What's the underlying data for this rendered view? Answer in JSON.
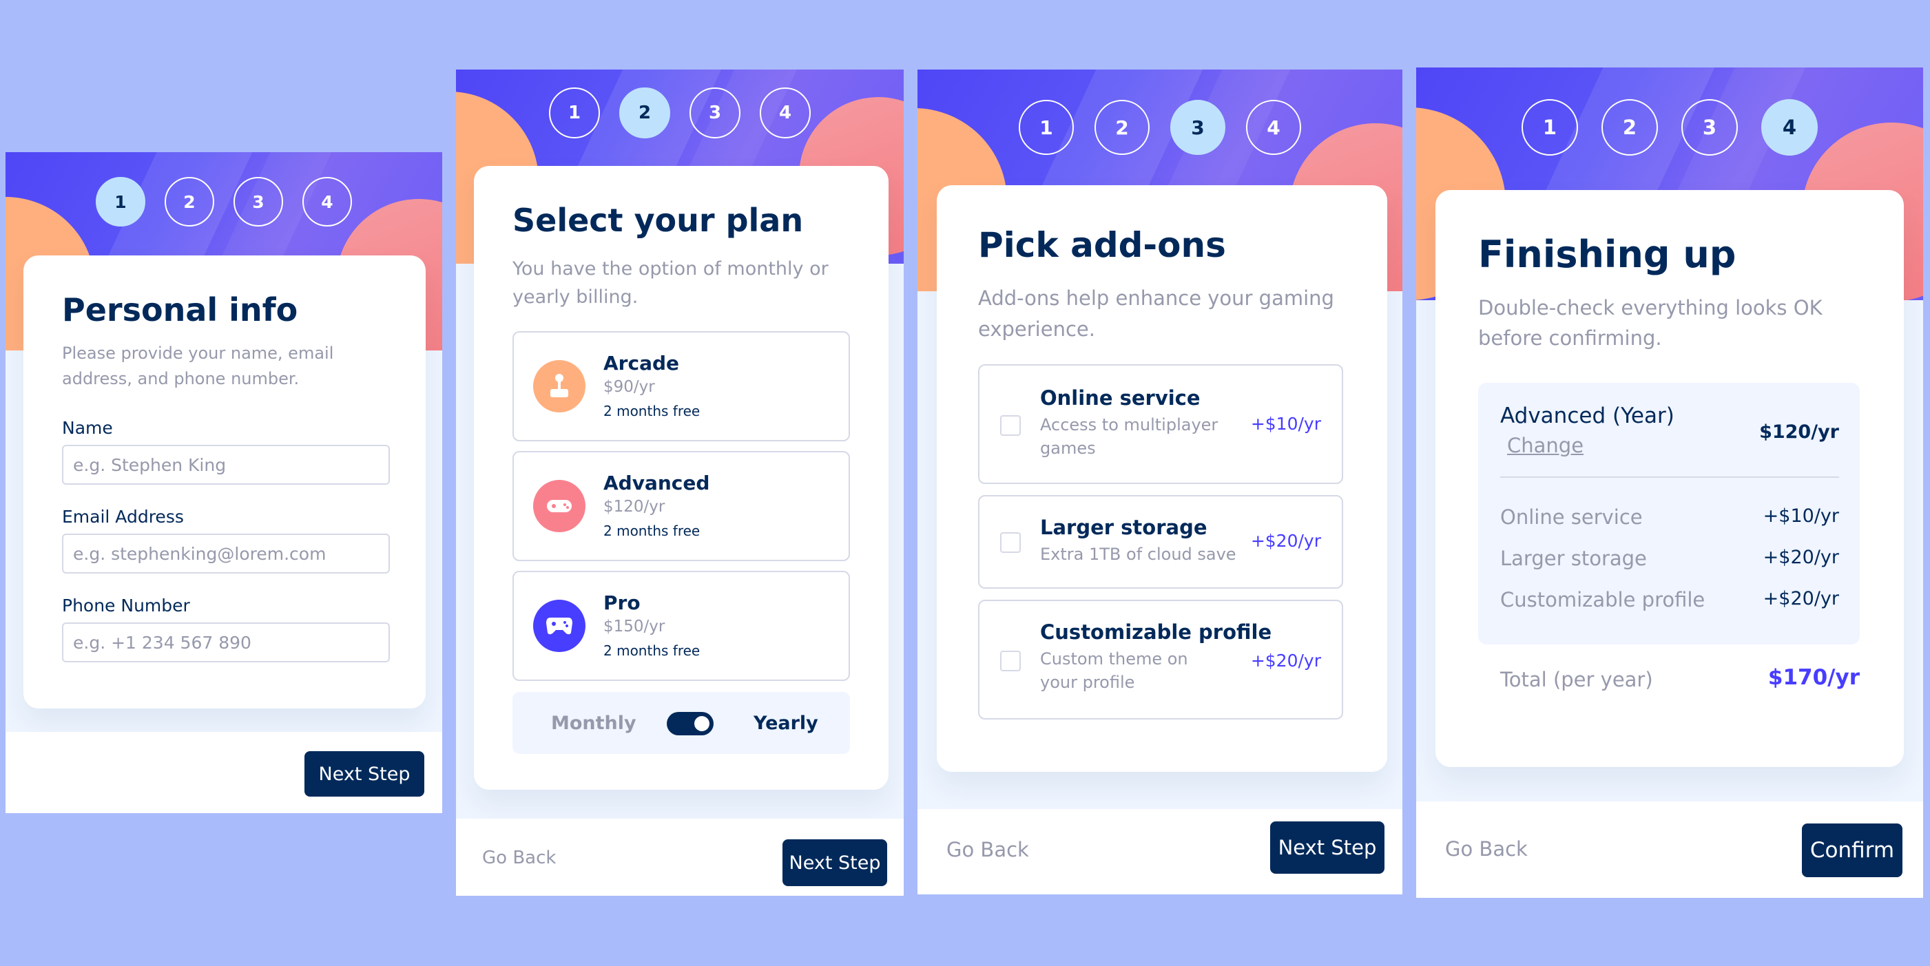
{
  "personal": {
    "steps": [
      "1",
      "2",
      "3",
      "4"
    ],
    "title": "Personal info",
    "subtitle": "Please provide your name, email address, and phone number.",
    "fields": [
      {
        "label": "Name",
        "placeholder": "e.g. Stephen King"
      },
      {
        "label": "Email Address",
        "placeholder": "e.g. stephenking@lorem.com"
      },
      {
        "label": "Phone Number",
        "placeholder": "e.g. +1 234 567 890"
      }
    ],
    "next": "Next Step"
  },
  "plan": {
    "steps": [
      "1",
      "2",
      "3",
      "4"
    ],
    "title": "Select your plan",
    "subtitle": "You have the option of monthly or yearly billing.",
    "plans": [
      {
        "name": "Arcade",
        "price": "$90/yr",
        "free": "2 months free",
        "icon": "arcade-icon",
        "color": "#ffaf7e"
      },
      {
        "name": "Advanced",
        "price": "$120/yr",
        "free": "2 months free",
        "icon": "gamepad-icon",
        "color": "#f9818e"
      },
      {
        "name": "Pro",
        "price": "$150/yr",
        "free": "2 months free",
        "icon": "controller-icon",
        "color": "#483eff"
      }
    ],
    "toggle": {
      "monthly": "Monthly",
      "yearly": "Yearly"
    },
    "back": "Go Back",
    "next": "Next Step"
  },
  "addons": {
    "steps": [
      "1",
      "2",
      "3",
      "4"
    ],
    "title": "Pick add-ons",
    "subtitle": "Add-ons help enhance your gaming experience.",
    "items": [
      {
        "name": "Online service",
        "desc": "Access to multiplayer games",
        "price": "+$10/yr"
      },
      {
        "name": "Larger storage",
        "desc": "Extra 1TB of cloud save",
        "price": "+$20/yr"
      },
      {
        "name": "Customizable profile",
        "desc": "Custom theme on your profile",
        "price": "+$20/yr"
      }
    ],
    "back": "Go Back",
    "next": "Next Step"
  },
  "summary": {
    "steps": [
      "1",
      "2",
      "3",
      "4"
    ],
    "title": "Finishing up",
    "subtitle": "Double-check everything looks OK before confirming.",
    "plan_name": "Advanced (Year)",
    "change": "Change",
    "plan_price": "$120/yr",
    "addons": [
      {
        "name": "Online service",
        "price": "+$10/yr"
      },
      {
        "name": "Larger storage",
        "price": "+$20/yr"
      },
      {
        "name": "Customizable profile",
        "price": "+$20/yr"
      }
    ],
    "total_label": "Total (per year)",
    "total_value": "$170/yr",
    "back": "Go Back",
    "confirm": "Confirm"
  },
  "colors": {
    "background": "#aabbfb",
    "marine_blue": "#02295a",
    "purplish_blue": "#473dff",
    "light_blue": "#bee2fd",
    "cool_gray": "#9699ab",
    "light_gray": "#d6d9e6",
    "magnolia": "#f8f9fe",
    "alabaster": "#eef5ff"
  }
}
